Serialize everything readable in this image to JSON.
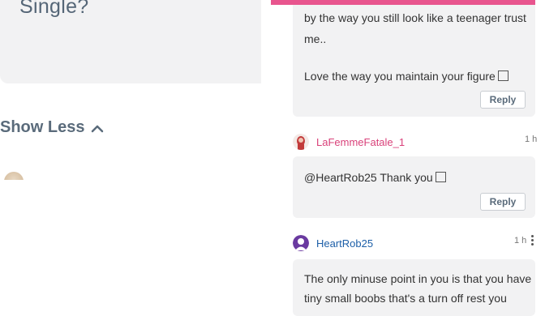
{
  "left": {
    "card_title": "Single?",
    "show_less_label": "Show Less"
  },
  "comments": [
    {
      "lines": [
        "by the way you still look like a teenager trust",
        "me..",
        "",
        "Love the way you maintain your figure"
      ],
      "reply_label": "Reply"
    },
    {
      "username": "LaFemmeFatale_1",
      "time": "1 h",
      "text": "@HeartRob25 Thank you",
      "reply_label": "Reply"
    },
    {
      "username": "HeartRob25",
      "time": "1 h",
      "lines": [
        "The only minuse point in you is that you have",
        "tiny small boobs that's a turn off rest you"
      ]
    }
  ],
  "colors": {
    "accent_pink": "#e8558e",
    "username_pink": "#d9417a",
    "username_blue": "#1d5fa8",
    "bubble_bg": "#f2f2f3"
  },
  "icons": {
    "show_less": "chevron-up-icon",
    "menu": "kebab-menu-icon"
  }
}
